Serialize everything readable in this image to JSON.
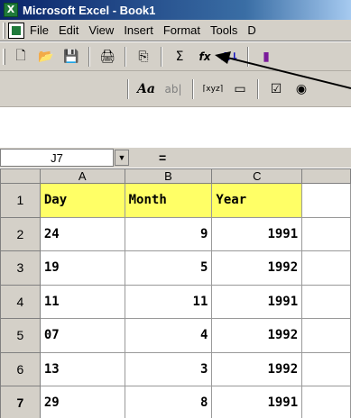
{
  "window": {
    "title": "Microsoft Excel - Book1",
    "app_icon": "excel-icon"
  },
  "menu": {
    "items": [
      "File",
      "Edit",
      "View",
      "Insert",
      "Format",
      "Tools",
      "D"
    ]
  },
  "toolbar_standard": {
    "icons": [
      "new-icon",
      "open-icon",
      "save-icon",
      "print-icon",
      "copy-icon",
      "autosum-icon",
      "function-icon",
      "sort-ascending-icon",
      "chart-icon"
    ],
    "glyphs": [
      "🗋",
      "📂",
      "💾",
      "🖨",
      "⎘",
      "Σ",
      "fx",
      "A↓",
      "▮"
    ]
  },
  "toolbar_forms": {
    "icons": [
      "label-icon",
      "edit-box-icon",
      "group-box-icon",
      "button-icon",
      "checkbox-icon",
      "option-button-icon"
    ],
    "glyphs": [
      "Aa",
      "ab|",
      "⌈xyz⌉",
      "▭",
      "☑",
      "◉"
    ]
  },
  "formula_bar": {
    "name_box": "J7",
    "equals": "="
  },
  "columns": [
    "A",
    "B",
    "C"
  ],
  "rows": [
    {
      "num": "1",
      "day": "Day",
      "month": "Month",
      "year": "Year"
    },
    {
      "num": "2",
      "day": "24",
      "month": "9",
      "year": "1991"
    },
    {
      "num": "3",
      "day": "19",
      "month": "5",
      "year": "1992"
    },
    {
      "num": "4",
      "day": "11",
      "month": "11",
      "year": "1991"
    },
    {
      "num": "5",
      "day": "07",
      "month": "4",
      "year": "1992"
    },
    {
      "num": "6",
      "day": "13",
      "month": "3",
      "year": "1992"
    },
    {
      "num": "7",
      "day": "29",
      "month": "8",
      "year": "1991"
    }
  ],
  "annotation": {
    "arrow_target": "menu-item-insert"
  },
  "colors": {
    "header_fill": "#ffff66",
    "chrome": "#d4d0c8",
    "titlebar": "#0a246a"
  }
}
